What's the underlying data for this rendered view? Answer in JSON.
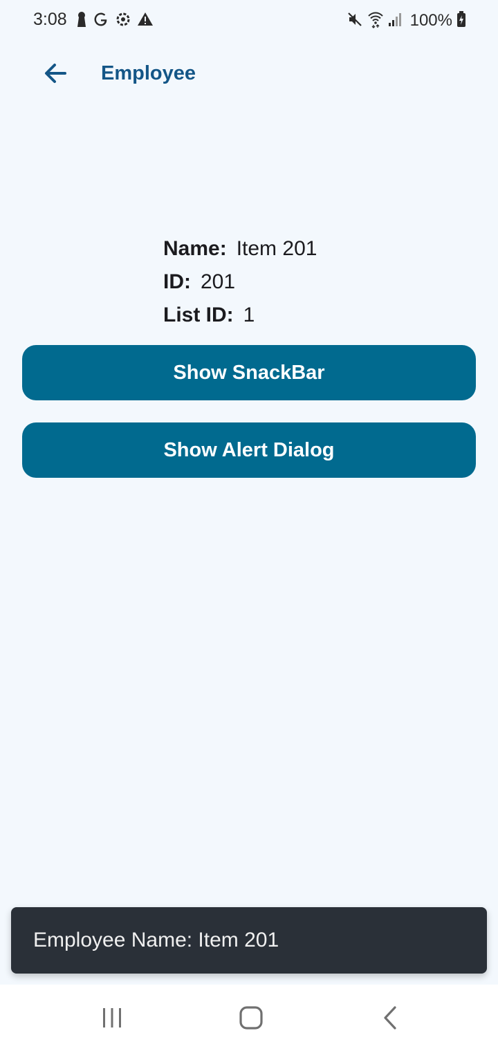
{
  "status_bar": {
    "time": "3:08",
    "battery": "100%",
    "left_icons": [
      "keyhole-notification-icon",
      "google-icon",
      "settings-notification-icon",
      "warning-icon"
    ],
    "right_icons": [
      "mute-icon",
      "wifi-icon",
      "signal-icon",
      "battery-icon"
    ]
  },
  "app_bar": {
    "title": "Employee",
    "back_icon": "arrow-left-icon",
    "title_color": "#145687"
  },
  "details": {
    "name_label": "Name:",
    "name_value": "Item 201",
    "id_label": "ID:",
    "id_value": "201",
    "list_id_label": "List ID:",
    "list_id_value": "1"
  },
  "buttons": {
    "snackbar_label": "Show SnackBar",
    "alert_label": "Show Alert Dialog",
    "color": "#016a8f"
  },
  "snackbar": {
    "message": "Employee Name: Item 201"
  },
  "nav_bar": {
    "icons": [
      "recent-apps-icon",
      "home-icon",
      "back-icon"
    ]
  }
}
